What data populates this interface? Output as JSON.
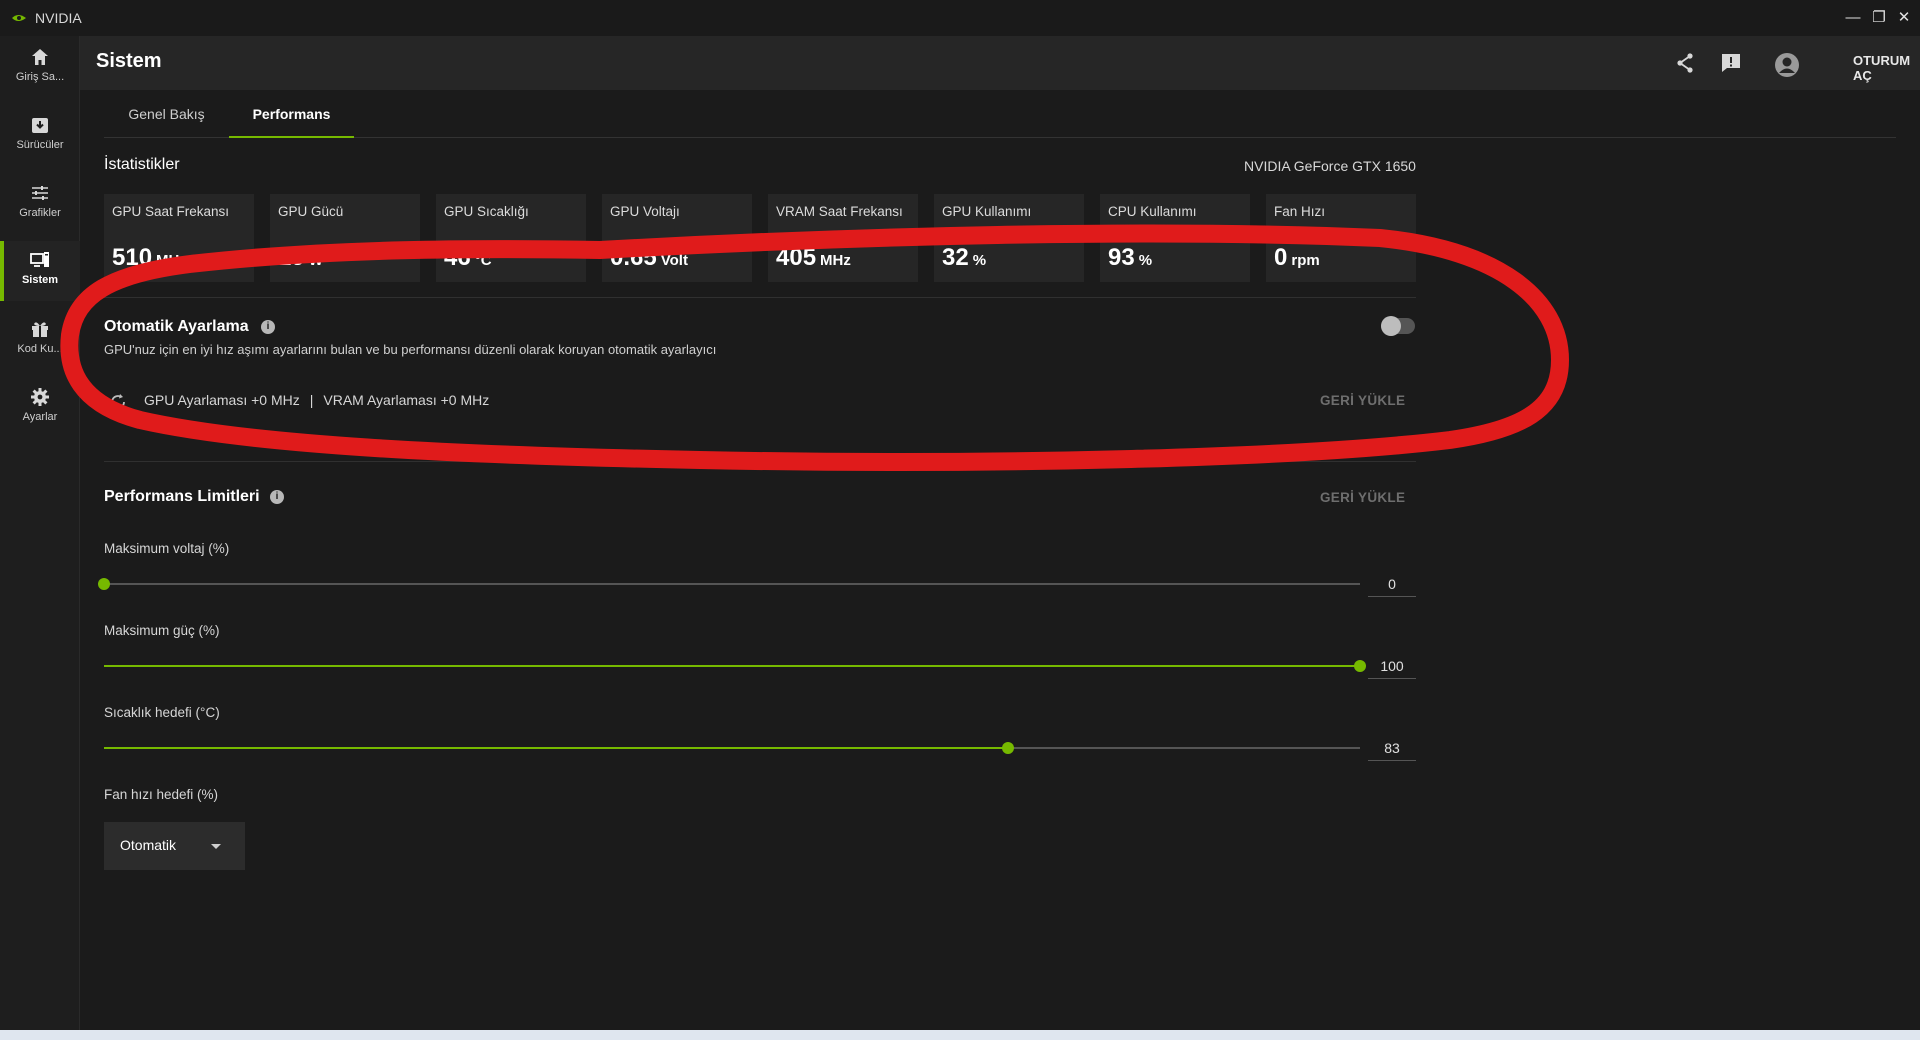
{
  "titlebar": {
    "app_name": "NVIDIA"
  },
  "sidebar": {
    "items": [
      {
        "label": "Giriş Sa..."
      },
      {
        "label": "Sürücüler"
      },
      {
        "label": "Grafikler"
      },
      {
        "label": "Sistem"
      },
      {
        "label": "Kod Ku..."
      },
      {
        "label": "Ayarlar"
      }
    ]
  },
  "header": {
    "title": "Sistem",
    "login_label": "OTURUM AÇ"
  },
  "tabs": [
    {
      "label": "Genel Bakış"
    },
    {
      "label": "Performans"
    }
  ],
  "stats": {
    "title": "İstatistikler",
    "gpu_name": "NVIDIA GeForce GTX 1650",
    "cards": [
      {
        "label": "GPU Saat Frekansı",
        "value": "510",
        "unit": "MHz"
      },
      {
        "label": "GPU Gücü",
        "value": "19",
        "unit": "W"
      },
      {
        "label": "GPU Sıcaklığı",
        "value": "46",
        "unit": "°C"
      },
      {
        "label": "GPU Voltajı",
        "value": "0.65",
        "unit": "Volt"
      },
      {
        "label": "VRAM Saat Frekansı",
        "value": "405",
        "unit": "MHz"
      },
      {
        "label": "GPU Kullanımı",
        "value": "32",
        "unit": "%"
      },
      {
        "label": "CPU Kullanımı",
        "value": "93",
        "unit": "%"
      },
      {
        "label": "Fan Hızı",
        "value": "0",
        "unit": "rpm"
      }
    ]
  },
  "auto_tune": {
    "title": "Otomatik Ayarlama",
    "description": "GPU'nuz için en iyi hız aşımı ayarlarını bulan ve bu performansı düzenli olarak koruyan otomatik ayarlayıcı",
    "enabled": false,
    "gpu_tuning": "GPU Ayarlaması +0 MHz",
    "separator": "|",
    "vram_tuning": "VRAM Ayarlaması +0 MHz",
    "reset_label": "GERİ YÜKLE"
  },
  "limits": {
    "title": "Performans Limitleri",
    "reset_label": "GERİ YÜKLE",
    "sliders": [
      {
        "label": "Maksimum voltaj (%)",
        "value": "0",
        "fraction": 0.0
      },
      {
        "label": "Maksimum güç (%)",
        "value": "100",
        "fraction": 1.0
      },
      {
        "label": "Sıcaklık hedefi (°C)",
        "value": "83",
        "fraction": 0.72
      }
    ],
    "fan_label": "Fan hızı hedefi (%)",
    "fan_mode": "Otomatik"
  },
  "colors": {
    "accent": "#76b900",
    "annotation": "#e01b1b"
  }
}
